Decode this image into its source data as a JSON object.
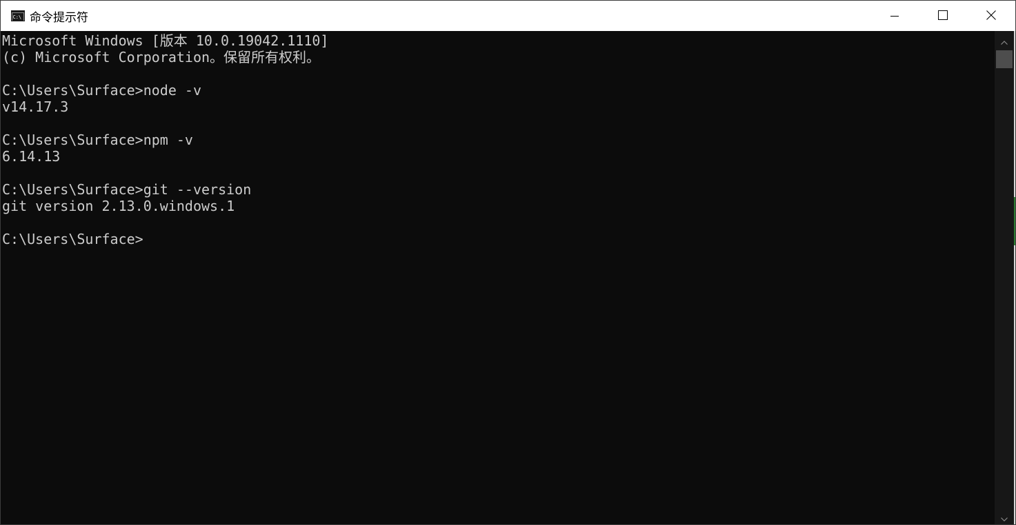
{
  "window": {
    "title": "命令提示符",
    "app_icon": "cmd-icon",
    "controls": {
      "minimize_icon": "minimize-icon",
      "maximize_icon": "maximize-icon",
      "close_icon": "close-icon"
    }
  },
  "console": {
    "lines": [
      "Microsoft Windows [版本 10.0.19042.1110]",
      "(c) Microsoft Corporation。保留所有权利。",
      "",
      "C:\\Users\\Surface>node -v",
      "v14.17.3",
      "",
      "C:\\Users\\Surface>npm -v",
      "6.14.13",
      "",
      "C:\\Users\\Surface>git --version",
      "git version 2.13.0.windows.1",
      "",
      "C:\\Users\\Surface>"
    ]
  },
  "scrollbar": {
    "up_icon": "chevron-up-icon",
    "down_icon": "chevron-down-icon"
  },
  "colors": {
    "console_background": "#0c0c0c",
    "console_text": "#cccccc",
    "titlebar_background": "#ffffff",
    "scroll_thumb": "#4d4d4d"
  }
}
